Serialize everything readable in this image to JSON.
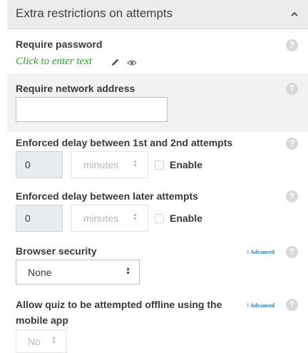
{
  "section": {
    "title": "Extra restrictions on attempts"
  },
  "require_password": {
    "label": "Require password",
    "value_placeholder": "Click to enter text",
    "help": "?"
  },
  "require_network": {
    "label": "Require network address",
    "value": "",
    "help": "?"
  },
  "delay_first": {
    "label": "Enforced delay between 1st and 2nd attempts",
    "value": "0",
    "unit": "minutes",
    "enable_label": "Enable",
    "enabled": false,
    "help": "?"
  },
  "delay_later": {
    "label": "Enforced delay between later attempts",
    "value": "0",
    "unit": "minutes",
    "enable_label": "Enable",
    "enabled": false,
    "help": "?"
  },
  "browser_security": {
    "label": "Browser security",
    "advanced": "! Advanced",
    "selected": "None",
    "help": "?"
  },
  "offline": {
    "label_line1": "Allow quiz to be attempted offline using the",
    "label_line2": "mobile app",
    "advanced": "! Advanced",
    "selected": "No",
    "help": "?"
  },
  "colors": {
    "header_bg": "#ececec",
    "highlight_row": "#f2f2f2",
    "click_text": "#2aa52a",
    "advanced_link": "#1f7ac6",
    "help_icon": "#d9d9d9"
  }
}
